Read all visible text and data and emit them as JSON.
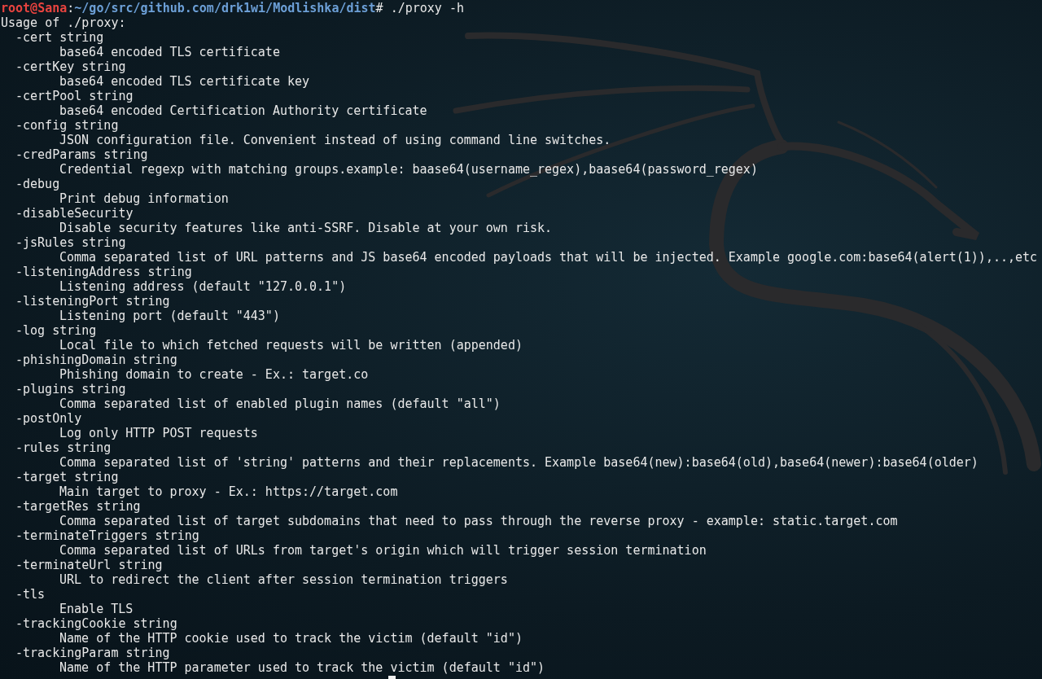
{
  "prompt": {
    "user_host": "root@Sana",
    "separator": ":",
    "path": "~/go/src/github.com/drk1wi/Modlishka/dist",
    "command": "# ./proxy -h"
  },
  "usage": "Usage of ./proxy:",
  "options": [
    {
      "flag": "-cert string",
      "description": "base64 encoded TLS certificate"
    },
    {
      "flag": "-certKey string",
      "description": "base64 encoded TLS certificate key"
    },
    {
      "flag": "-certPool string",
      "description": "base64 encoded Certification Authority certificate"
    },
    {
      "flag": "-config string",
      "description": "JSON configuration file. Convenient instead of using command line switches."
    },
    {
      "flag": "-credParams string",
      "description": "Credential regexp with matching groups.example: baase64(username_regex),baase64(password_regex)"
    },
    {
      "flag": "-debug",
      "description": "Print debug information"
    },
    {
      "flag": "-disableSecurity",
      "description": "Disable security features like anti-SSRF. Disable at your own risk."
    },
    {
      "flag": "-jsRules string",
      "description": "Comma separated list of URL patterns and JS base64 encoded payloads that will be injected. Example google.com:base64(alert(1)),..,etc"
    },
    {
      "flag": "-listeningAddress string",
      "description": "Listening address (default \"127.0.0.1\")"
    },
    {
      "flag": "-listeningPort string",
      "description": "Listening port (default \"443\")"
    },
    {
      "flag": "-log string",
      "description": "Local file to which fetched requests will be written (appended)"
    },
    {
      "flag": "-phishingDomain string",
      "description": "Phishing domain to create - Ex.: target.co"
    },
    {
      "flag": "-plugins string",
      "description": "Comma separated list of enabled plugin names (default \"all\")"
    },
    {
      "flag": "-postOnly",
      "description": "Log only HTTP POST requests"
    },
    {
      "flag": "-rules string",
      "description": "Comma separated list of 'string' patterns and their replacements. Example base64(new):base64(old),base64(newer):base64(older)"
    },
    {
      "flag": "-target string",
      "description": "Main target to proxy - Ex.: https://target.com"
    },
    {
      "flag": "-targetRes string",
      "description": "Comma separated list of target subdomains that need to pass through the reverse proxy - example: static.target.com"
    },
    {
      "flag": "-terminateTriggers string",
      "description": "Comma separated list of URLs from target's origin which will trigger session termination"
    },
    {
      "flag": "-terminateUrl string",
      "description": "URL to redirect the client after session termination triggers"
    },
    {
      "flag": "-tls",
      "description": "Enable TLS"
    },
    {
      "flag": "-trackingCookie string",
      "description": "Name of the HTTP cookie used to track the victim (default \"id\")"
    },
    {
      "flag": "-trackingParam string",
      "description": "Name of the HTTP parameter used to track the victim (default \"id\")"
    }
  ]
}
